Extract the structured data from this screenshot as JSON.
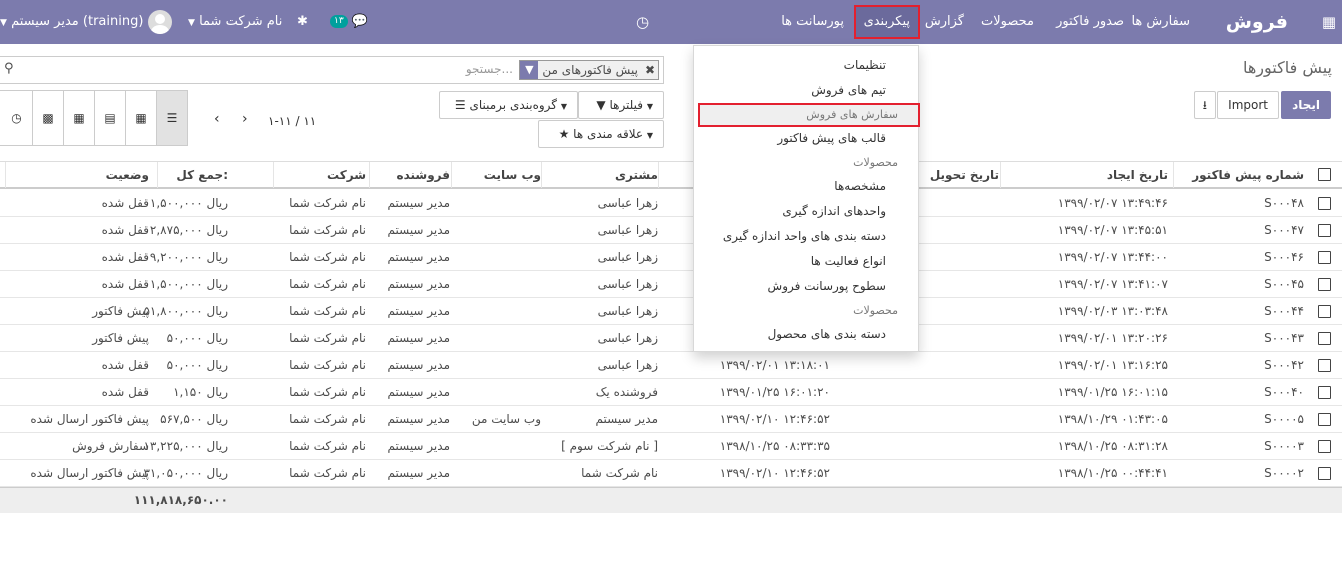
{
  "topbar": {
    "app_name": "فروش",
    "menu": [
      "سفارش ها",
      "صدور فاکتور",
      "محصولات",
      "گزارش",
      "پیکربندی",
      "پورسانت ها"
    ],
    "active_menu": "پیکربندی",
    "company": "نام شرکت شما",
    "messages_count": "۱۳",
    "user": "مدیر سیستم (training)",
    "colors": {
      "bar": "#7c7bad",
      "highlight": "#e3202f",
      "badge": "#00a09d"
    }
  },
  "breadcrumb": "پیش فاکتورها",
  "buttons": {
    "create": "ایجاد",
    "import": "Import"
  },
  "search": {
    "facet": "پیش فاکتورهای من",
    "placeholder": "جستجو..."
  },
  "filters": {
    "filters": "فیلترها",
    "groupby": "گروه‌بندی برمبنای",
    "favorites": "علاقه مندی ها"
  },
  "pager": "۱-۱۱ / ۱۱",
  "table": {
    "headers": [
      "شماره پیش فاکتور",
      "تاریخ ایجاد",
      "تاریخ تحویل",
      "مشتری",
      "وب سایت",
      "فروشنده",
      "شرکت",
      "جمع کل:",
      "وضعیت"
    ],
    "rows": [
      {
        "num": "S۰۰۰۴۸",
        "created": "۱۳۹۹/۰۲/۰۷ ۱۳:۴۹:۴۶",
        "delivery": "",
        "customer": "زهرا عباسی",
        "website": "",
        "seller": "مدیر سیستم",
        "company": "نام شرکت شما",
        "total": "۱,۵۰۰,۰۰۰ ریال",
        "status": "قفل شده"
      },
      {
        "num": "S۰۰۰۴۷",
        "created": "۱۳۹۹/۰۲/۰۷ ۱۳:۴۵:۵۱",
        "delivery": "",
        "customer": "زهرا عباسی",
        "website": "",
        "seller": "مدیر سیستم",
        "company": "نام شرکت شما",
        "total": "۲,۸۷۵,۰۰۰ ریال",
        "status": "قفل شده"
      },
      {
        "num": "S۰۰۰۴۶",
        "created": "۱۳۹۹/۰۲/۰۷ ۱۳:۴۴:۰۰",
        "delivery": "",
        "customer": "زهرا عباسی",
        "website": "",
        "seller": "مدیر سیستم",
        "company": "نام شرکت شما",
        "total": "۹,۲۰۰,۰۰۰ ریال",
        "status": "قفل شده"
      },
      {
        "num": "S۰۰۰۴۵",
        "created": "۱۳۹۹/۰۲/۰۷ ۱۳:۴۱:۰۷",
        "delivery": "",
        "customer": "زهرا عباسی",
        "website": "",
        "seller": "مدیر سیستم",
        "company": "نام شرکت شما",
        "total": "۱,۵۰۰,۰۰۰ ریال",
        "status": "قفل شده"
      },
      {
        "num": "S۰۰۰۴۴",
        "created": "۱۳۹۹/۰۲/۰۳ ۱۳:۰۳:۴۸",
        "delivery": "",
        "customer": "زهرا عباسی",
        "website": "",
        "seller": "مدیر سیستم",
        "company": "نام شرکت شما",
        "total": "۵۱,۸۰۰,۰۰۰ ریال",
        "status": "پیش فاکتور"
      },
      {
        "num": "S۰۰۰۴۳",
        "created": "۱۳۹۹/۰۲/۰۱ ۱۳:۲۰:۲۶",
        "delivery": "",
        "customer": "زهرا عباسی",
        "website": "",
        "seller": "مدیر سیستم",
        "company": "نام شرکت شما",
        "total": "۵۰,۰۰۰ ریال",
        "status": "پیش فاکتور"
      },
      {
        "num": "S۰۰۰۴۲",
        "created": "۱۳۹۹/۰۲/۰۱ ۱۳:۱۶:۲۵",
        "delivery": "۱۳۹۹/۰۲/۰۱ ۱۳:۱۸:۰۱",
        "customer": "زهرا عباسی",
        "website": "",
        "seller": "مدیر سیستم",
        "company": "نام شرکت شما",
        "total": "۵۰,۰۰۰ ریال",
        "status": "قفل شده"
      },
      {
        "num": "S۰۰۰۴۰",
        "created": "۱۳۹۹/۰۱/۲۵ ۱۶:۰۱:۱۵",
        "delivery": "۱۳۹۹/۰۱/۲۵ ۱۶:۰۱:۲۰",
        "customer": "فروشنده یک",
        "website": "",
        "seller": "مدیر سیستم",
        "company": "نام شرکت شما",
        "total": "۱,۱۵۰ ریال",
        "status": "قفل شده"
      },
      {
        "num": "S۰۰۰۰۵",
        "created": "۱۳۹۸/۱۰/۲۹ ۰۱:۴۳:۰۵",
        "delivery": "۱۳۹۹/۰۲/۱۰ ۱۲:۴۶:۵۲",
        "customer": "مدیر سیستم",
        "website": "وب سایت من",
        "seller": "مدیر سیستم",
        "company": "نام شرکت شما",
        "total": "۵۶۷,۵۰۰ ریال",
        "status": "پیش فاکتور ارسال شده"
      },
      {
        "num": "S۰۰۰۰۳",
        "created": "۱۳۹۸/۱۰/۲۵ ۰۸:۳۱:۲۸",
        "delivery": "۱۳۹۸/۱۰/۲۵ ۰۸:۳۳:۳۵",
        "customer": "[ نام شرکت سوم ]",
        "website": "",
        "seller": "مدیر سیستم",
        "company": "نام شرکت شما",
        "total": "۱۳,۲۲۵,۰۰۰ ریال",
        "status": "سفارش فروش"
      },
      {
        "num": "S۰۰۰۰۲",
        "created": "۱۳۹۸/۱۰/۲۵ ۰۰:۴۴:۴۱",
        "delivery": "۱۳۹۹/۰۲/۱۰ ۱۲:۴۶:۵۲",
        "customer": "نام شرکت شما",
        "website": "",
        "seller": "مدیر سیستم",
        "company": "نام شرکت شما",
        "total": "۳۱,۰۵۰,۰۰۰ ریال",
        "status": "پیش فاکتور ارسال شده"
      }
    ],
    "sum": "۱۱۱,۸۱۸,۶۵۰.۰۰"
  },
  "dropdown": {
    "items": [
      {
        "type": "item",
        "label": "تنظیمات"
      },
      {
        "type": "item",
        "label": "تیم های فروش",
        "selected": true
      },
      {
        "type": "header",
        "label": "سفارش های فروش"
      },
      {
        "type": "item",
        "label": "قالب های پیش فاکتور"
      },
      {
        "type": "header",
        "label": "محصولات"
      },
      {
        "type": "item",
        "label": "مشخصه‌ها"
      },
      {
        "type": "item",
        "label": "واحدهای اندازه گیری"
      },
      {
        "type": "item",
        "label": "دسته بندی های واحد اندازه گیری"
      },
      {
        "type": "item",
        "label": "انواع فعالیت ها"
      },
      {
        "type": "item",
        "label": "سطوح پورسانت فروش"
      },
      {
        "type": "header",
        "label": "محصولات"
      },
      {
        "type": "item",
        "label": "دسته بندی های محصول"
      }
    ]
  }
}
